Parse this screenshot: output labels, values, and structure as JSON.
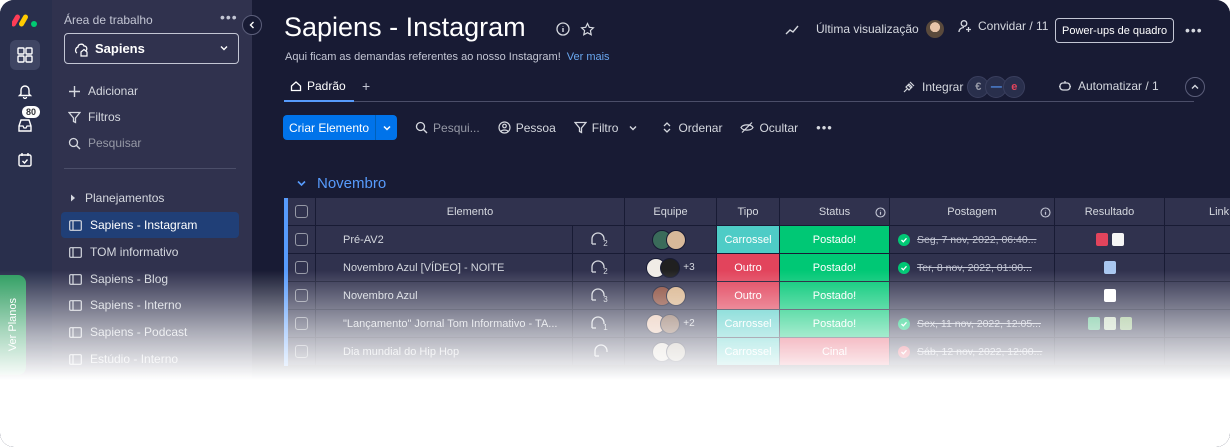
{
  "rail": {
    "badge_count": "80",
    "ver_planos": "Ver Planos"
  },
  "sidebar": {
    "title": "Área de trabalho",
    "workspace": "Sapiens",
    "actions": {
      "add": "Adicionar",
      "filters": "Filtros",
      "search": "Pesquisar"
    },
    "folder": "Planejamentos",
    "boards": [
      "Sapiens - Instagram",
      "TOM informativo",
      "Sapiens - Blog",
      "Sapiens - Interno",
      "Sapiens - Podcast",
      "Estúdio - Interno"
    ]
  },
  "header": {
    "title": "Sapiens - Instagram",
    "description": "Aqui ficam as demandas referentes ao nosso Instagram!",
    "see_more": "Ver mais",
    "last_viewed": "Última visualização",
    "invite": "Convidar / 11",
    "powerups": "Power-ups de quadro"
  },
  "views": {
    "default_tab": "Padrão",
    "add": "+",
    "integrate": "Integrar",
    "automate": "Automatizar / 1"
  },
  "toolbar": {
    "create": "Criar Elemento",
    "search": "Pesqui...",
    "person": "Pessoa",
    "filter": "Filtro",
    "sort": "Ordenar",
    "hide": "Ocultar"
  },
  "group": {
    "title": "Novembro"
  },
  "table": {
    "columns": {
      "element": "Elemento",
      "team": "Equipe",
      "type": "Tipo",
      "status": "Status",
      "posting": "Postagem",
      "result": "Resultado",
      "link": "Link"
    },
    "rows": [
      {
        "name": "Pré-AV2",
        "updates": "2",
        "extra": "",
        "type": "Carrossel",
        "status": "Postado!",
        "date": "Seg, 7 nov, 2022, 06:40...",
        "done": true
      },
      {
        "name": "Novembro Azul [VÍDEO] - NOITE",
        "updates": "2",
        "extra": "+3",
        "type": "Outro",
        "status": "Postado!",
        "date": "Ter, 8 nov, 2022, 01:00...",
        "done": true
      },
      {
        "name": "Novembro Azul",
        "updates": "3",
        "extra": "",
        "type": "Outro",
        "status": "Postado!",
        "date": "",
        "done": false
      },
      {
        "name": "\"Lançamento\" Jornal Tom Informativo - TA...",
        "updates": "1",
        "extra": "+2",
        "type": "Carrossel",
        "status": "Postado!",
        "date": "Sex, 11 nov, 2022, 12:05...",
        "done": true
      },
      {
        "name": "Dia mundial do Hip Hop",
        "updates": "",
        "extra": "",
        "type": "Carrossel",
        "status": "Cinal",
        "date": "Sáb, 12 nov, 2022, 12:00...",
        "done": false
      }
    ]
  },
  "colors": {
    "primary": "#0073ea",
    "group": "#579bfc",
    "carrossel": "#4eccc6",
    "outro": "#e2445c",
    "postado": "#00c875",
    "final": "#e2445c"
  }
}
